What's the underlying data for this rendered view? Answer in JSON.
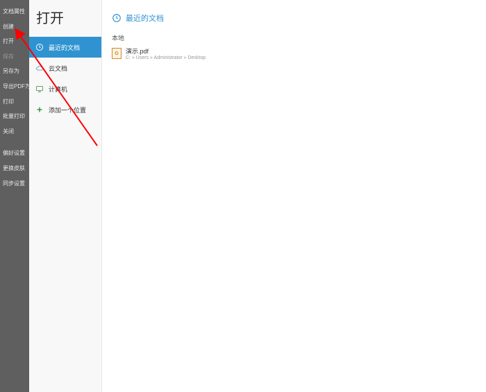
{
  "sidebar": {
    "items": [
      {
        "label": "文档属性"
      },
      {
        "label": "创建"
      },
      {
        "label": "打开"
      },
      {
        "label": "保存",
        "dim": true
      },
      {
        "label": "另存为"
      },
      {
        "label": "导出PDF为"
      },
      {
        "label": "打印"
      },
      {
        "label": "批量打印"
      },
      {
        "label": "关闭"
      }
    ],
    "items2": [
      {
        "label": "偏好设置"
      },
      {
        "label": "更换皮肤"
      },
      {
        "label": "同步设置"
      }
    ]
  },
  "page": {
    "title": "打开"
  },
  "middle": {
    "items": [
      {
        "label": "最近的文档",
        "icon": "clock",
        "active": true
      },
      {
        "label": "云文档",
        "icon": "cloud"
      },
      {
        "label": "计算机",
        "icon": "computer"
      },
      {
        "label": "添加一个位置",
        "icon": "plus"
      }
    ]
  },
  "main": {
    "heading": "最近的文档",
    "section_label": "本地",
    "files": [
      {
        "name": "演示.pdf",
        "path": "C: » Users » Administrator » Desktop",
        "badge": "G"
      }
    ]
  }
}
